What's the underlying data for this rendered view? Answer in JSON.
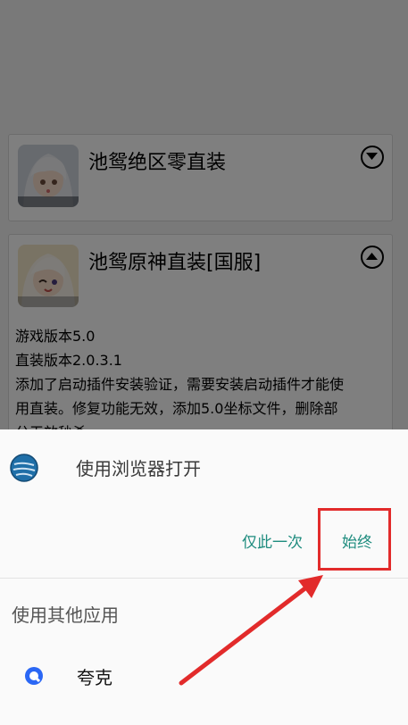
{
  "cards": [
    {
      "title": "池鸳绝区零直装",
      "expanded": false,
      "icon": "character-avatar-icon"
    },
    {
      "title": "池鸳原神直装[国服]",
      "expanded": true,
      "icon": "character-avatar-icon",
      "description_lines": [
        "游戏版本5.0",
        "直装版本2.0.3.1",
        "添加了启动插件安装验证，需要安装启动插件才能使",
        "用直装。修复功能无效，添加5.0坐标文件，删除部",
        "分无效秒杀"
      ]
    }
  ],
  "sheet": {
    "title": "使用浏览器打开",
    "just_once": "仅此一次",
    "always": "始终",
    "other_apps_label": "使用其他应用",
    "apps": [
      {
        "label": "夸克",
        "icon": "quark-browser-icon"
      }
    ]
  },
  "colors": {
    "accent": "#1e8c7e",
    "highlight": "#e22b2b",
    "quark_blue": "#2a67f5"
  }
}
